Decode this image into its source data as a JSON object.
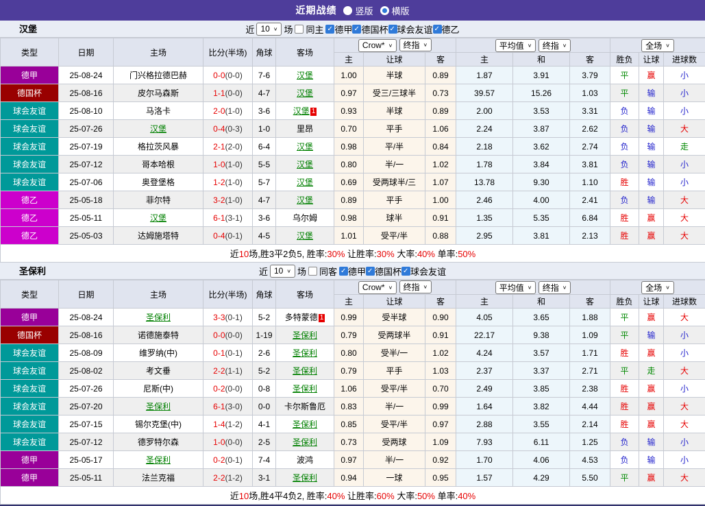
{
  "top_bar": {
    "title": "近期战绩",
    "options": [
      {
        "label": "竖版",
        "selected": false
      },
      {
        "label": "横版",
        "selected": true
      }
    ]
  },
  "league_colors": {
    "德甲": "#990099",
    "德国杯": "#990000",
    "球会友谊": "#009999",
    "德乙": "#cc00cc"
  },
  "result_colors": {
    "胜": "red",
    "平": "green",
    "负": "blue",
    "赢": "red",
    "输": "blue",
    "走": "green",
    "大": "red",
    "小": "blue"
  },
  "table_header": {
    "cols": [
      "类型",
      "日期",
      "主场",
      "比分(半场)",
      "角球",
      "客场"
    ],
    "selects": {
      "book": "Crow*",
      "final1": "终指",
      "avg": "平均值",
      "final2": "终指",
      "scope": "全场"
    },
    "sub": [
      "主",
      "让球",
      "客",
      "主",
      "和",
      "客",
      "胜负",
      "让球",
      "进球数"
    ]
  },
  "sections": [
    {
      "team": "汉堡",
      "filter": {
        "near": "近",
        "count": "10",
        "games": "场",
        "same_side_label": "同主",
        "same_side_checked": false,
        "leagues": [
          {
            "label": "德甲",
            "checked": true
          },
          {
            "label": "德国杯",
            "checked": true
          },
          {
            "label": "球会友谊",
            "checked": true
          },
          {
            "label": "德乙",
            "checked": true
          }
        ]
      },
      "rows": [
        {
          "league": "德甲",
          "date": "25-08-24",
          "home": "门兴格拉德巴赫",
          "home_focus": false,
          "home_card": "",
          "score": "0-0",
          "half": "(0-0)",
          "corner": "7-6",
          "away": "汉堡",
          "away_focus": true,
          "away_card": "",
          "odds_home": "1.00",
          "line": "半球",
          "odds_away": "0.89",
          "avg_home": "1.87",
          "avg_draw": "3.91",
          "avg_away": "3.79",
          "wdl": "平",
          "hres": "赢",
          "goals": "小"
        },
        {
          "league": "德国杯",
          "date": "25-08-16",
          "home": "皮尔马森斯",
          "home_focus": false,
          "home_card": "",
          "score": "1-1",
          "half": "(0-0)",
          "corner": "4-7",
          "away": "汉堡",
          "away_focus": true,
          "away_card": "",
          "odds_home": "0.97",
          "line": "受三/三球半",
          "odds_away": "0.73",
          "avg_home": "39.57",
          "avg_draw": "15.26",
          "avg_away": "1.03",
          "wdl": "平",
          "hres": "输",
          "goals": "小"
        },
        {
          "league": "球会友谊",
          "date": "25-08-10",
          "home": "马洛卡",
          "home_focus": false,
          "home_card": "",
          "score": "2-0",
          "half": "(1-0)",
          "corner": "3-6",
          "away": "汉堡",
          "away_focus": true,
          "away_card": "1",
          "odds_home": "0.93",
          "line": "半球",
          "odds_away": "0.89",
          "avg_home": "2.00",
          "avg_draw": "3.53",
          "avg_away": "3.31",
          "wdl": "负",
          "hres": "输",
          "goals": "小"
        },
        {
          "league": "球会友谊",
          "date": "25-07-26",
          "home": "汉堡",
          "home_focus": true,
          "home_card": "",
          "score": "0-4",
          "half": "(0-3)",
          "corner": "1-0",
          "away": "里昂",
          "away_focus": false,
          "away_card": "",
          "odds_home": "0.70",
          "line": "平手",
          "odds_away": "1.06",
          "avg_home": "2.24",
          "avg_draw": "3.87",
          "avg_away": "2.62",
          "wdl": "负",
          "hres": "输",
          "goals": "大"
        },
        {
          "league": "球会友谊",
          "date": "25-07-19",
          "home": "格拉茨风暴",
          "home_focus": false,
          "home_card": "",
          "score": "2-1",
          "half": "(2-0)",
          "corner": "6-4",
          "away": "汉堡",
          "away_focus": true,
          "away_card": "",
          "odds_home": "0.98",
          "line": "平/半",
          "odds_away": "0.84",
          "avg_home": "2.18",
          "avg_draw": "3.62",
          "avg_away": "2.74",
          "wdl": "负",
          "hres": "输",
          "goals": "走"
        },
        {
          "league": "球会友谊",
          "date": "25-07-12",
          "home": "哥本哈根",
          "home_focus": false,
          "home_card": "",
          "score": "1-0",
          "half": "(1-0)",
          "corner": "5-5",
          "away": "汉堡",
          "away_focus": true,
          "away_card": "",
          "odds_home": "0.80",
          "line": "半/一",
          "odds_away": "1.02",
          "avg_home": "1.78",
          "avg_draw": "3.84",
          "avg_away": "3.81",
          "wdl": "负",
          "hres": "输",
          "goals": "小"
        },
        {
          "league": "球会友谊",
          "date": "25-07-06",
          "home": "奥登堡格",
          "home_focus": false,
          "home_card": "",
          "score": "1-2",
          "half": "(1-0)",
          "corner": "5-7",
          "away": "汉堡",
          "away_focus": true,
          "away_card": "",
          "odds_home": "0.69",
          "line": "受两球半/三",
          "odds_away": "1.07",
          "avg_home": "13.78",
          "avg_draw": "9.30",
          "avg_away": "1.10",
          "wdl": "胜",
          "hres": "输",
          "goals": "小"
        },
        {
          "league": "德乙",
          "date": "25-05-18",
          "home": "菲尔特",
          "home_focus": false,
          "home_card": "",
          "score": "3-2",
          "half": "(1-0)",
          "corner": "4-7",
          "away": "汉堡",
          "away_focus": true,
          "away_card": "",
          "odds_home": "0.89",
          "line": "平手",
          "odds_away": "1.00",
          "avg_home": "2.46",
          "avg_draw": "4.00",
          "avg_away": "2.41",
          "wdl": "负",
          "hres": "输",
          "goals": "大"
        },
        {
          "league": "德乙",
          "date": "25-05-11",
          "home": "汉堡",
          "home_focus": true,
          "home_card": "",
          "score": "6-1",
          "half": "(3-1)",
          "corner": "3-6",
          "away": "乌尔姆",
          "away_focus": false,
          "away_card": "",
          "odds_home": "0.98",
          "line": "球半",
          "odds_away": "0.91",
          "avg_home": "1.35",
          "avg_draw": "5.35",
          "avg_away": "6.84",
          "wdl": "胜",
          "hres": "赢",
          "goals": "大"
        },
        {
          "league": "德乙",
          "date": "25-05-03",
          "home": "达姆施塔特",
          "home_focus": false,
          "home_card": "",
          "score": "0-4",
          "half": "(0-1)",
          "corner": "4-5",
          "away": "汉堡",
          "away_focus": true,
          "away_card": "",
          "odds_home": "1.01",
          "line": "受平/半",
          "odds_away": "0.88",
          "avg_home": "2.95",
          "avg_draw": "3.81",
          "avg_away": "2.13",
          "wdl": "胜",
          "hres": "赢",
          "goals": "大"
        }
      ],
      "summary": [
        {
          "text": "近",
          "red": false
        },
        {
          "text": "10",
          "red": true
        },
        {
          "text": "场,胜3平2负5, 胜率:",
          "red": false
        },
        {
          "text": "30%",
          "red": true
        },
        {
          "text": " 让胜率:",
          "red": false
        },
        {
          "text": "30%",
          "red": true
        },
        {
          "text": " 大率:",
          "red": false
        },
        {
          "text": "40%",
          "red": true
        },
        {
          "text": " 单率:",
          "red": false
        },
        {
          "text": "50%",
          "red": true
        }
      ]
    },
    {
      "team": "圣保利",
      "filter": {
        "near": "近",
        "count": "10",
        "games": "场",
        "same_side_label": "同客",
        "same_side_checked": false,
        "leagues": [
          {
            "label": "德甲",
            "checked": true
          },
          {
            "label": "德国杯",
            "checked": true
          },
          {
            "label": "球会友谊",
            "checked": true
          }
        ]
      },
      "rows": [
        {
          "league": "德甲",
          "date": "25-08-24",
          "home": "圣保利",
          "home_focus": true,
          "home_card": "",
          "score": "3-3",
          "half": "(0-1)",
          "corner": "5-2",
          "away": "多特蒙德",
          "away_focus": false,
          "away_card": "1",
          "odds_home": "0.99",
          "line": "受半球",
          "odds_away": "0.90",
          "avg_home": "4.05",
          "avg_draw": "3.65",
          "avg_away": "1.88",
          "wdl": "平",
          "hres": "赢",
          "goals": "大"
        },
        {
          "league": "德国杯",
          "date": "25-08-16",
          "home": "诺德施泰特",
          "home_focus": false,
          "home_card": "",
          "score": "0-0",
          "half": "(0-0)",
          "corner": "1-19",
          "away": "圣保利",
          "away_focus": true,
          "away_card": "",
          "odds_home": "0.79",
          "line": "受两球半",
          "odds_away": "0.91",
          "avg_home": "22.17",
          "avg_draw": "9.38",
          "avg_away": "1.09",
          "wdl": "平",
          "hres": "输",
          "goals": "小"
        },
        {
          "league": "球会友谊",
          "date": "25-08-09",
          "home": "维罗纳(中)",
          "home_focus": false,
          "home_card": "",
          "score": "0-1",
          "half": "(0-1)",
          "corner": "2-6",
          "away": "圣保利",
          "away_focus": true,
          "away_card": "",
          "odds_home": "0.80",
          "line": "受半/一",
          "odds_away": "1.02",
          "avg_home": "4.24",
          "avg_draw": "3.57",
          "avg_away": "1.71",
          "wdl": "胜",
          "hres": "赢",
          "goals": "小"
        },
        {
          "league": "球会友谊",
          "date": "25-08-02",
          "home": "考文垂",
          "home_focus": false,
          "home_card": "",
          "score": "2-2",
          "half": "(1-1)",
          "corner": "5-2",
          "away": "圣保利",
          "away_focus": true,
          "away_card": "",
          "odds_home": "0.79",
          "line": "平手",
          "odds_away": "1.03",
          "avg_home": "2.37",
          "avg_draw": "3.37",
          "avg_away": "2.71",
          "wdl": "平",
          "hres": "走",
          "goals": "大"
        },
        {
          "league": "球会友谊",
          "date": "25-07-26",
          "home": "尼斯(中)",
          "home_focus": false,
          "home_card": "",
          "score": "0-2",
          "half": "(0-0)",
          "corner": "0-8",
          "away": "圣保利",
          "away_focus": true,
          "away_card": "",
          "odds_home": "1.06",
          "line": "受平/半",
          "odds_away": "0.70",
          "avg_home": "2.49",
          "avg_draw": "3.85",
          "avg_away": "2.38",
          "wdl": "胜",
          "hres": "赢",
          "goals": "小"
        },
        {
          "league": "球会友谊",
          "date": "25-07-20",
          "home": "圣保利",
          "home_focus": true,
          "home_card": "",
          "score": "6-1",
          "half": "(3-0)",
          "corner": "0-0",
          "away": "卡尔斯鲁厄",
          "away_focus": false,
          "away_card": "",
          "odds_home": "0.83",
          "line": "半/一",
          "odds_away": "0.99",
          "avg_home": "1.64",
          "avg_draw": "3.82",
          "avg_away": "4.44",
          "wdl": "胜",
          "hres": "赢",
          "goals": "大"
        },
        {
          "league": "球会友谊",
          "date": "25-07-15",
          "home": "锡尔克堡(中)",
          "home_focus": false,
          "home_card": "",
          "score": "1-4",
          "half": "(1-2)",
          "corner": "4-1",
          "away": "圣保利",
          "away_focus": true,
          "away_card": "",
          "odds_home": "0.85",
          "line": "受平/半",
          "odds_away": "0.97",
          "avg_home": "2.88",
          "avg_draw": "3.55",
          "avg_away": "2.14",
          "wdl": "胜",
          "hres": "赢",
          "goals": "大"
        },
        {
          "league": "球会友谊",
          "date": "25-07-12",
          "home": "德罗特尔森",
          "home_focus": false,
          "home_card": "",
          "score": "1-0",
          "half": "(0-0)",
          "corner": "2-5",
          "away": "圣保利",
          "away_focus": true,
          "away_card": "",
          "odds_home": "0.73",
          "line": "受两球",
          "odds_away": "1.09",
          "avg_home": "7.93",
          "avg_draw": "6.11",
          "avg_away": "1.25",
          "wdl": "负",
          "hres": "输",
          "goals": "小"
        },
        {
          "league": "德甲",
          "date": "25-05-17",
          "home": "圣保利",
          "home_focus": true,
          "home_card": "",
          "score": "0-2",
          "half": "(0-1)",
          "corner": "7-4",
          "away": "波鸿",
          "away_focus": false,
          "away_card": "",
          "odds_home": "0.97",
          "line": "半/一",
          "odds_away": "0.92",
          "avg_home": "1.70",
          "avg_draw": "4.06",
          "avg_away": "4.53",
          "wdl": "负",
          "hres": "输",
          "goals": "小"
        },
        {
          "league": "德甲",
          "date": "25-05-11",
          "home": "法兰克福",
          "home_focus": false,
          "home_card": "",
          "score": "2-2",
          "half": "(1-2)",
          "corner": "3-1",
          "away": "圣保利",
          "away_focus": true,
          "away_card": "",
          "odds_home": "0.94",
          "line": "一球",
          "odds_away": "0.95",
          "avg_home": "1.57",
          "avg_draw": "4.29",
          "avg_away": "5.50",
          "wdl": "平",
          "hres": "赢",
          "goals": "大"
        }
      ],
      "summary": [
        {
          "text": "近",
          "red": false
        },
        {
          "text": "10",
          "red": true
        },
        {
          "text": "场,胜4平4负2, 胜率:",
          "red": false
        },
        {
          "text": "40%",
          "red": true
        },
        {
          "text": " 让胜率:",
          "red": false
        },
        {
          "text": "60%",
          "red": true
        },
        {
          "text": " 大率:",
          "red": false
        },
        {
          "text": "50%",
          "red": true
        },
        {
          "text": " 单率:",
          "red": false
        },
        {
          "text": "40%",
          "red": true
        }
      ]
    }
  ]
}
